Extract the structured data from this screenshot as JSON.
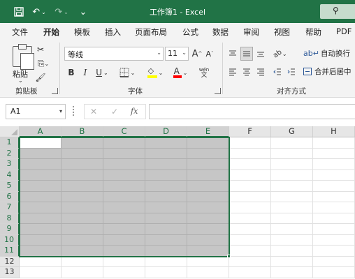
{
  "titlebar": {
    "title": "工作簿1 - Excel",
    "icons": [
      "save-icon",
      "undo-icon",
      "redo-icon",
      "customize-qat-icon",
      "search-icon"
    ],
    "undo_glyph": "↶",
    "redo_glyph": "↷",
    "qat_glyph": "⌄"
  },
  "tabs": [
    "文件",
    "开始",
    "模板",
    "插入",
    "页面布局",
    "公式",
    "数据",
    "审阅",
    "视图",
    "帮助",
    "PDF"
  ],
  "active_tab": "开始",
  "ribbon": {
    "clipboard": {
      "label": "剪贴板",
      "paste_label": "粘贴",
      "cut_icon": "cut-icon",
      "copy_icon": "copy-icon",
      "format_painter_icon": "format-painter-icon"
    },
    "font": {
      "label": "字体",
      "font_name": "等线",
      "font_size": "11",
      "increase_font": "A",
      "decrease_font": "A",
      "bold": "B",
      "italic": "I",
      "underline": "U",
      "font_color_letter": "A",
      "phonetic": "wén",
      "fill_color": "#ffff00",
      "font_color": "#ff0000"
    },
    "alignment": {
      "label": "对齐方式",
      "wrap_text": "自动换行",
      "merge_center": "合并后居中"
    }
  },
  "formula_bar": {
    "name_box": "A1",
    "cancel_glyph": "✕",
    "enter_glyph": "✓",
    "fx_glyph": "fx",
    "formula": ""
  },
  "sheet": {
    "columns": [
      "A",
      "B",
      "C",
      "D",
      "E",
      "F",
      "G",
      "H"
    ],
    "rows": [
      "1",
      "2",
      "3",
      "4",
      "5",
      "6",
      "7",
      "8",
      "9",
      "10",
      "11",
      "12",
      "13"
    ],
    "selected_range": "A1:E11",
    "active_cell": "A1"
  },
  "colors": {
    "accent": "#217346",
    "selection_fill": "#c6c6c6"
  }
}
